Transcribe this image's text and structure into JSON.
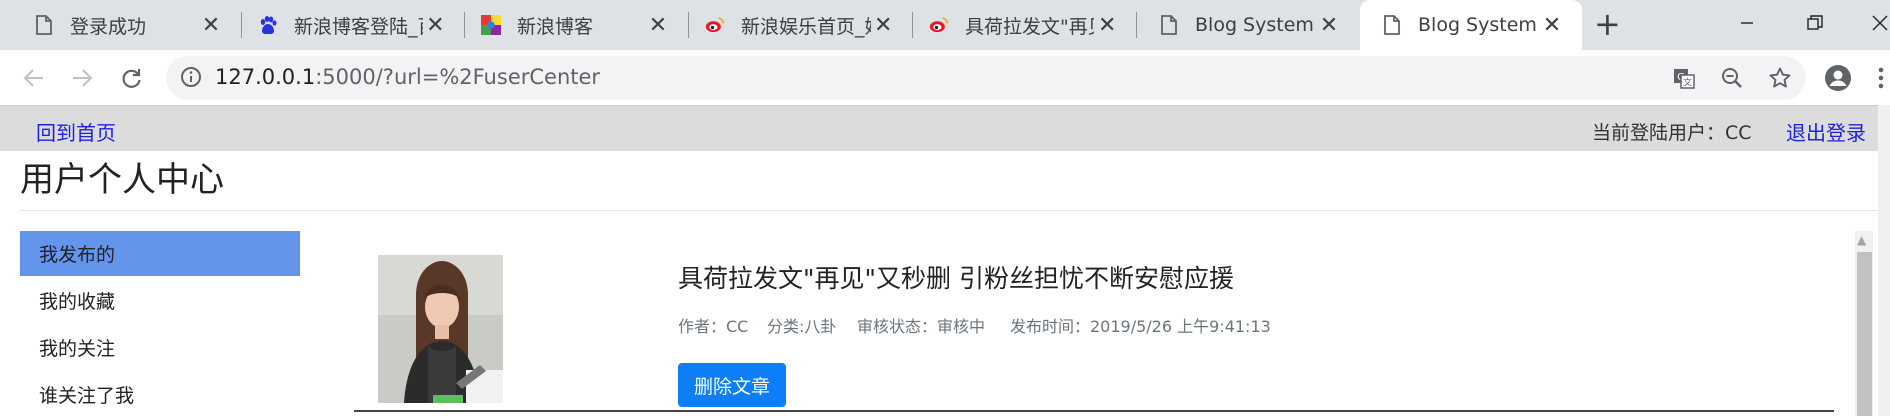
{
  "browser": {
    "tabs": [
      {
        "title": "登录成功",
        "icon": "page-icon"
      },
      {
        "title": "新浪博客登陆_百",
        "icon": "baidu-paw-icon"
      },
      {
        "title": "新浪博客",
        "icon": "colorful-squares-icon"
      },
      {
        "title": "新浪娱乐首页_娱",
        "icon": "weibo-icon"
      },
      {
        "title": "具荷拉发文\"再见",
        "icon": "weibo-icon"
      },
      {
        "title": "Blog System",
        "icon": "page-icon"
      },
      {
        "title": "Blog System",
        "icon": "page-icon"
      }
    ],
    "new_tab_label": "+",
    "close_glyph": "✕",
    "url_host": "127.0.0.1",
    "url_rest": ":5000/?url=%2FuserCenter"
  },
  "page": {
    "home_link": "回到首页",
    "current_user": "当前登陆用户：CC",
    "logout_link": "退出登录",
    "title": "用户个人中心",
    "sidebar": [
      {
        "label": "我发布的",
        "active": true
      },
      {
        "label": "我的收藏",
        "active": false
      },
      {
        "label": "我的关注",
        "active": false
      },
      {
        "label": "谁关注了我",
        "active": false
      }
    ],
    "post": {
      "title": "具荷拉发文\"再见\"又秒删 引粉丝担忧不断安慰应援",
      "author": "作者：CC",
      "category": "分类:八卦",
      "status": "审核状态：审核中",
      "published": "发布时间：2019/5/26 上午9:41:13",
      "delete_label": "删除文章"
    }
  },
  "colors": {
    "sidebar_active": "#6495ed",
    "delete_button": "#0d7ef7",
    "link": "#1f21e0"
  }
}
